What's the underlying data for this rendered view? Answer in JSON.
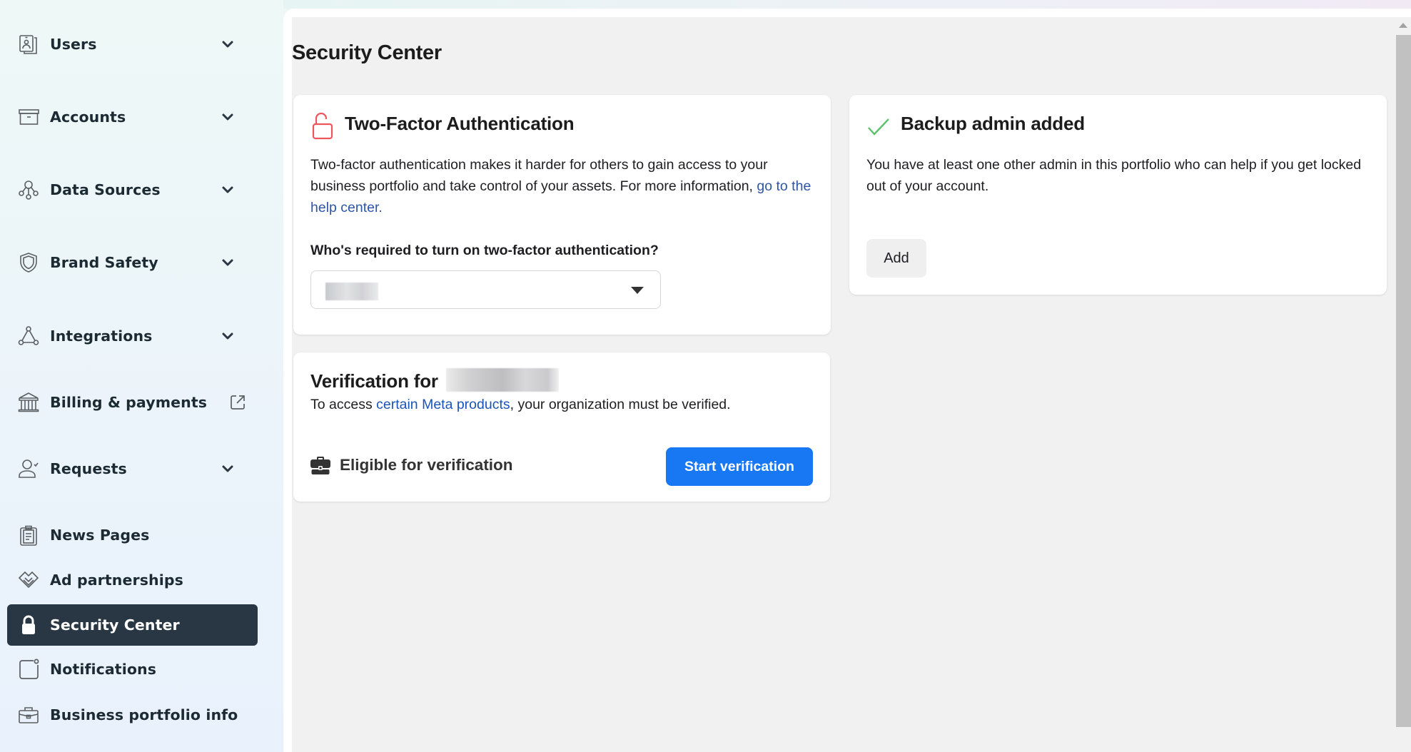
{
  "sidebar": {
    "items": [
      {
        "label": "Users",
        "icon": "id-badge-icon",
        "trailing": "chevron-down"
      },
      {
        "label": "Accounts",
        "icon": "archive-box-icon",
        "trailing": "chevron-down"
      },
      {
        "label": "Data Sources",
        "icon": "data-sources-icon",
        "trailing": "chevron-down"
      },
      {
        "label": "Brand Safety",
        "icon": "shield-icon",
        "trailing": "chevron-down"
      },
      {
        "label": "Integrations",
        "icon": "integrations-icon",
        "trailing": "chevron-down"
      },
      {
        "label": "Billing & payments",
        "icon": "bank-icon",
        "trailing": "external-link"
      },
      {
        "label": "Requests",
        "icon": "person-check-icon",
        "trailing": "chevron-down"
      },
      {
        "label": "News Pages",
        "icon": "clipboard-icon",
        "trailing": null
      },
      {
        "label": "Ad partnerships",
        "icon": "handshake-icon",
        "trailing": null
      },
      {
        "label": "Security Center",
        "icon": "lock-icon",
        "trailing": null,
        "active": true
      },
      {
        "label": "Notifications",
        "icon": "notification-icon",
        "trailing": null
      },
      {
        "label": "Business portfolio info",
        "icon": "briefcase-icon",
        "trailing": null
      }
    ]
  },
  "main": {
    "title": "Security Center",
    "two_factor": {
      "title": "Two-Factor Authentication",
      "icon": "unlock-icon",
      "icon_color": "#f0545d",
      "description_prefix": "Two-factor authentication makes it harder for others to gain access to your business portfolio and take control of your assets. For more information, ",
      "help_link": "go to the help center.",
      "question": "Who's required to turn on two-factor authentication?",
      "select_value": "[redacted]"
    },
    "backup_admin": {
      "title": "Backup admin added",
      "icon": "checkmark-icon",
      "icon_color": "#5ac26a",
      "description": "You have at least one other admin in this portfolio who can help if you get locked out of your account.",
      "add_button": "Add"
    },
    "verification": {
      "title_prefix": "Verification for",
      "org_name": "[redacted]",
      "description_prefix": "To access ",
      "products_link": "certain Meta products",
      "description_suffix": ", your organization must be verified.",
      "status": "Eligible for verification",
      "status_icon": "briefcase-filled-icon",
      "start_button": "Start verification",
      "accent_color": "#1877f2"
    }
  }
}
